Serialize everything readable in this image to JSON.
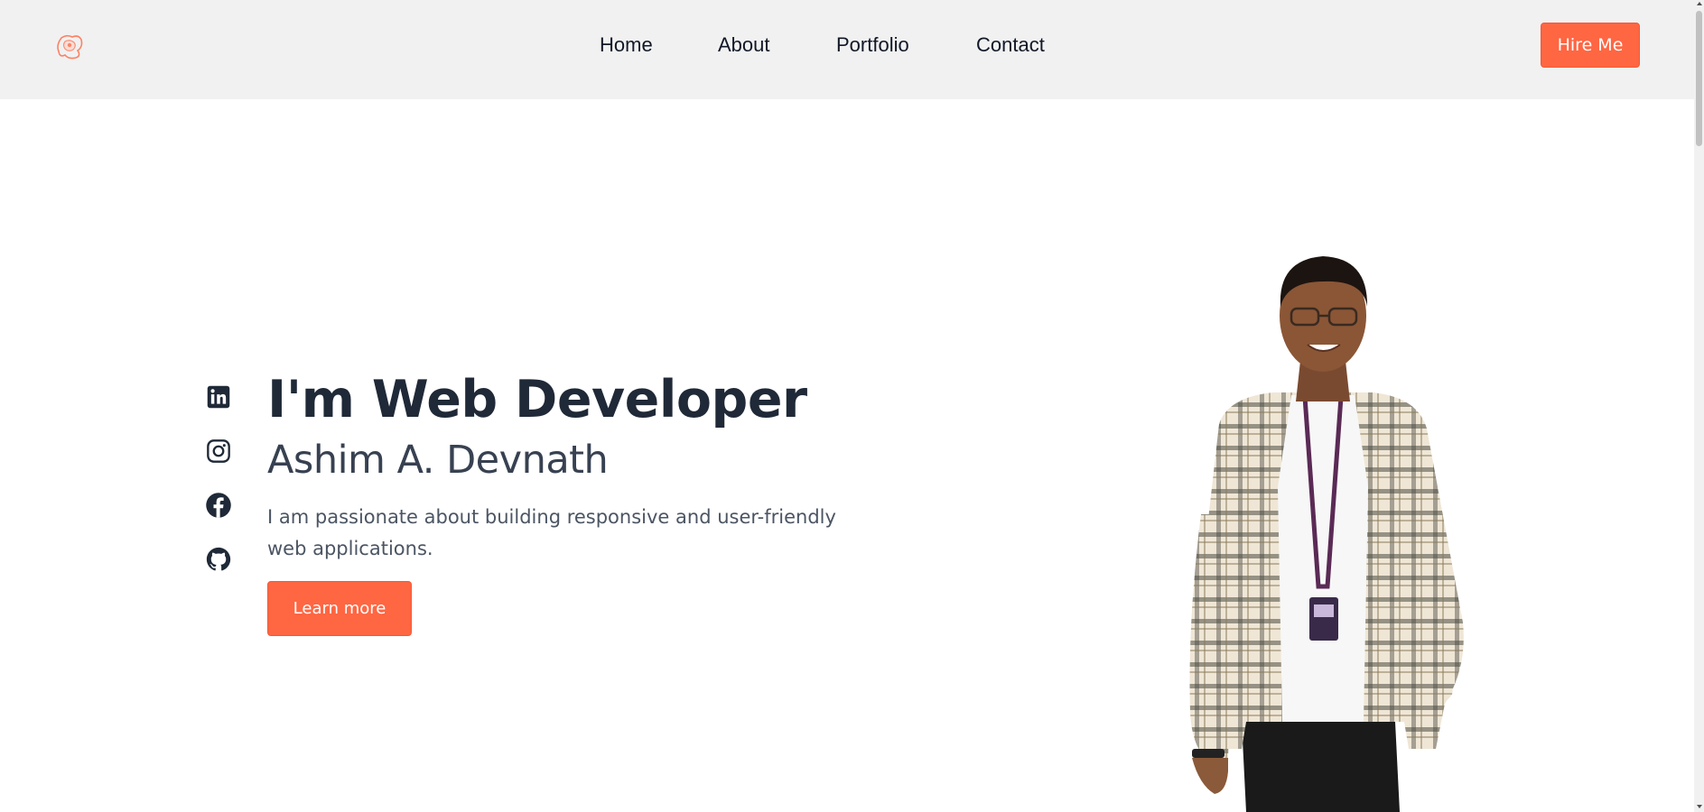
{
  "header": {
    "logo_icon": "logo-icon",
    "nav": [
      {
        "label": "Home"
      },
      {
        "label": "About"
      },
      {
        "label": "Portfolio"
      },
      {
        "label": "Contact"
      }
    ],
    "hire_label": "Hire Me"
  },
  "hero": {
    "title": "I'm Web Developer",
    "name": "Ashim A. Devnath",
    "description": "I am passionate about building responsive and user-friendly web applications.",
    "cta_label": "Learn more",
    "portrait_icon": "profile-photo"
  },
  "social": [
    {
      "icon": "linkedin-icon"
    },
    {
      "icon": "instagram-icon"
    },
    {
      "icon": "facebook-icon"
    },
    {
      "icon": "github-icon"
    }
  ],
  "colors": {
    "accent": "#ff6642",
    "header_bg": "#f1f1f1",
    "heading": "#1f2937",
    "body_text": "#4b5563"
  }
}
